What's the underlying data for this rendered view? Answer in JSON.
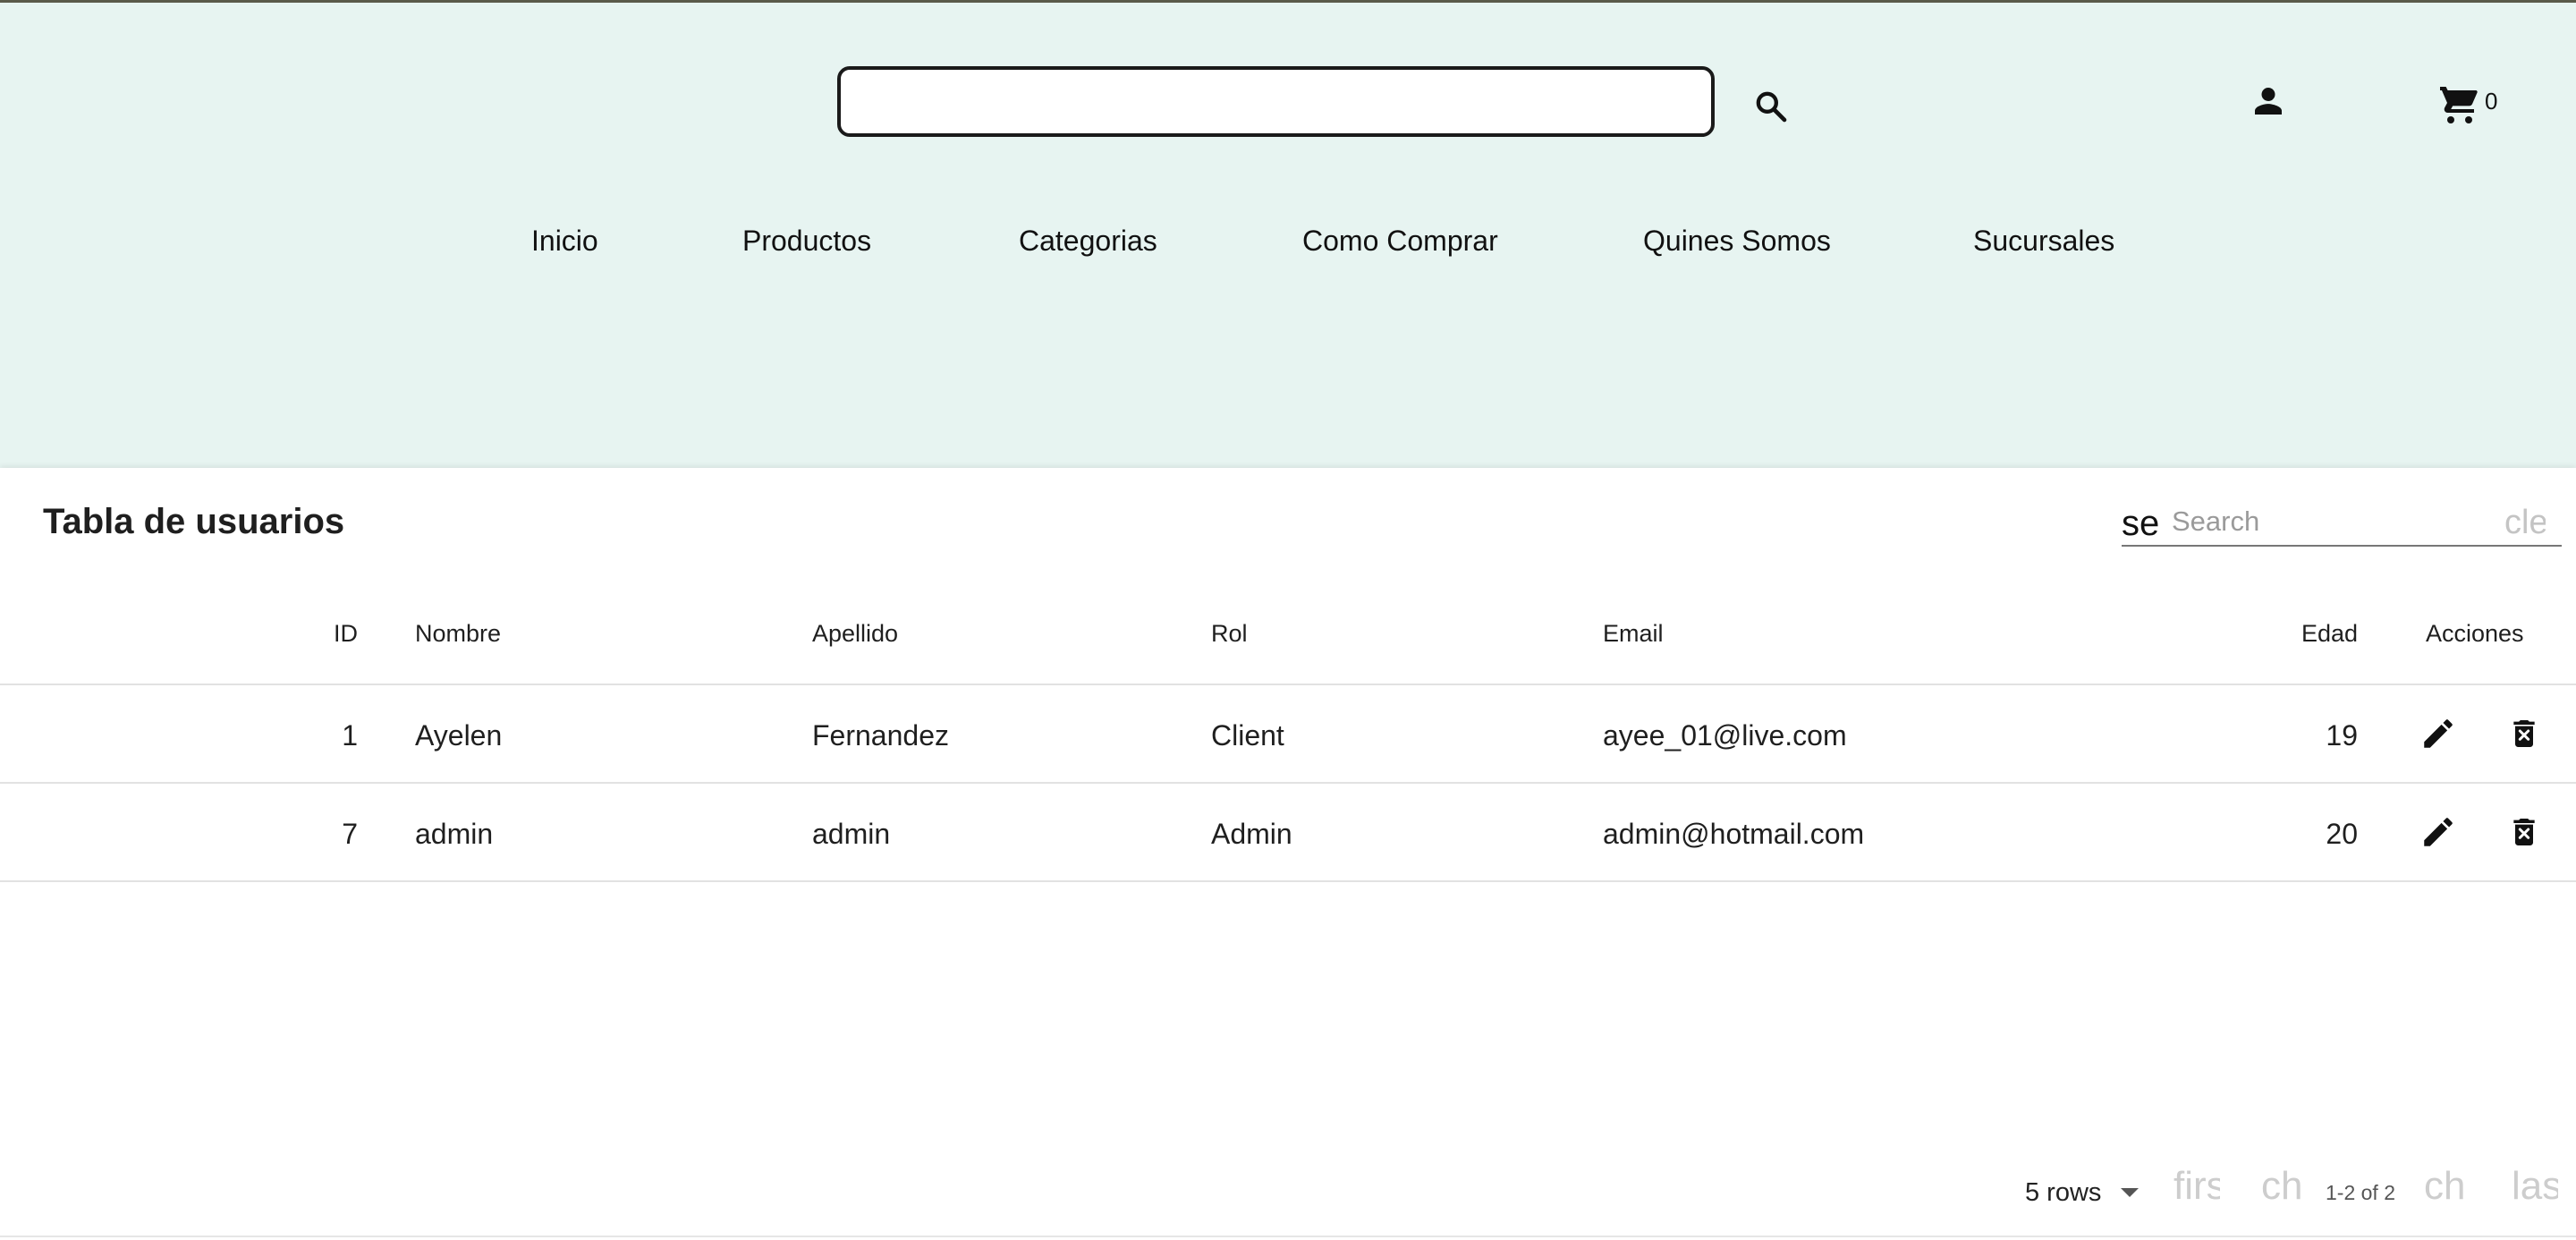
{
  "header": {
    "search": {
      "value": "",
      "placeholder": ""
    },
    "icons": {
      "search": "search-icon",
      "account": "person-icon",
      "cart": "cart-icon"
    },
    "cart_count": "0",
    "nav": [
      "Inicio",
      "Productos",
      "Categorias",
      "Como Comprar",
      "Quines Somos",
      "Sucursales"
    ]
  },
  "table": {
    "title": "Tabla de usuarios",
    "search": {
      "icon_text": "se",
      "placeholder": "Search",
      "clear_text": "cle"
    },
    "columns": [
      "ID",
      "Nombre",
      "Apellido",
      "Rol",
      "Email",
      "Edad",
      "Acciones"
    ],
    "rows": [
      {
        "id": "1",
        "nombre": "Ayelen",
        "apellido": "Fernandez",
        "rol": "Client",
        "email": "ayee_01@live.com",
        "edad": "19"
      },
      {
        "id": "7",
        "nombre": "admin",
        "apellido": "admin",
        "rol": "Admin",
        "email": "admin@hotmail.com",
        "edad": "20"
      }
    ],
    "action_icons": [
      "edit-icon",
      "delete-icon"
    ]
  },
  "pagination": {
    "rows_label": "5 rows",
    "first_text": "firs",
    "prev_text": "ch",
    "info": "1-2 of 2",
    "next_text": "ch",
    "last_text": "las"
  },
  "colors": {
    "header_bg": "#e7f4f1",
    "panel_bg": "#ffffff",
    "muted": "#cdcdcd"
  }
}
